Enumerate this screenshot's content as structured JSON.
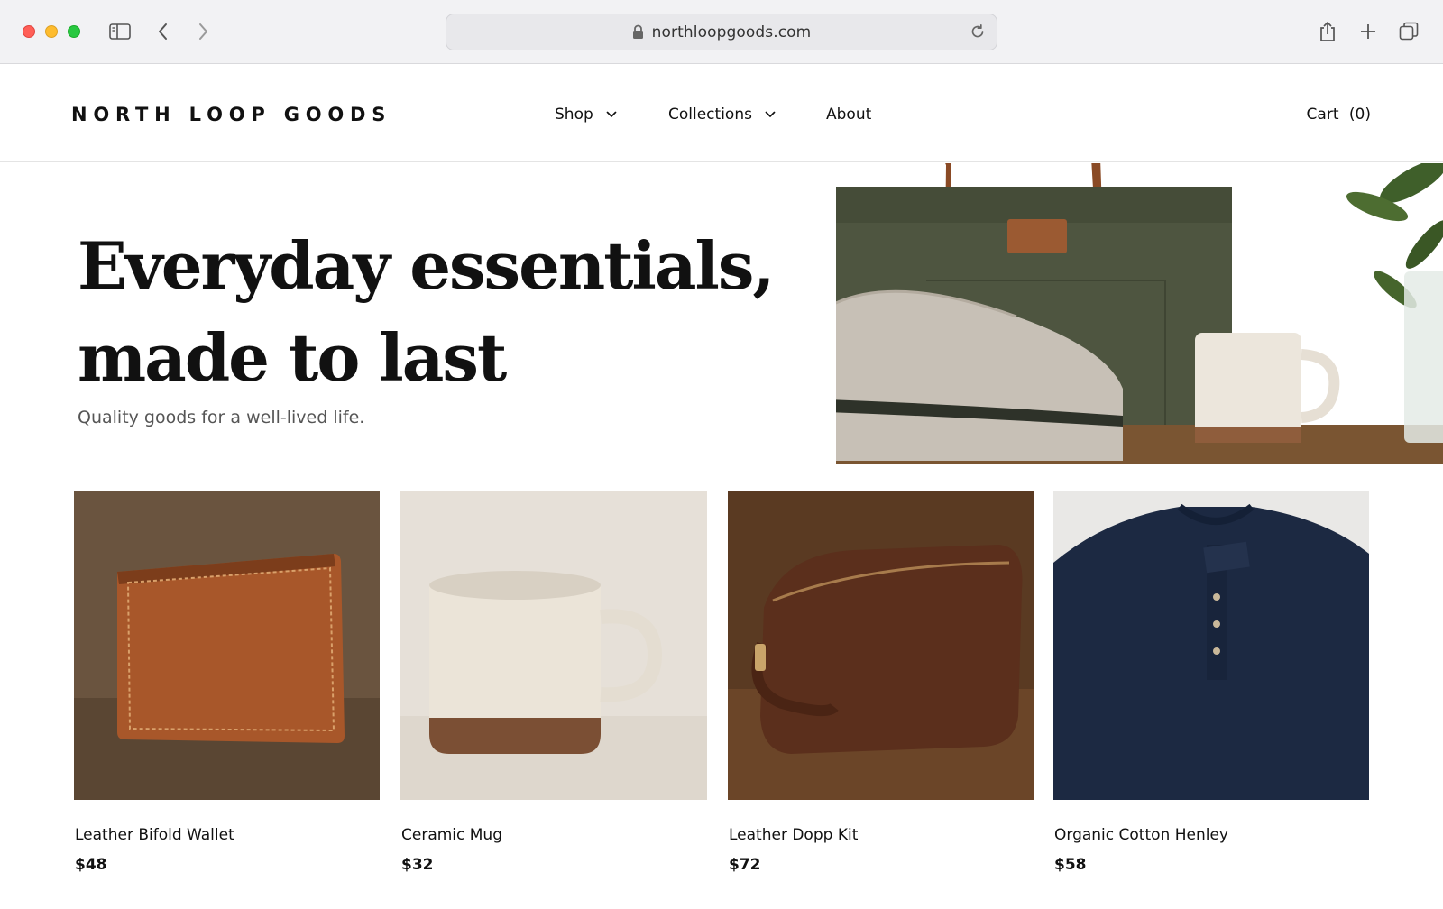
{
  "browser": {
    "url": "northloopgoods.com",
    "icons": [
      "sidebar-icon",
      "back-icon",
      "forward-icon",
      "lock-icon",
      "reload-icon",
      "share-icon",
      "new-tab-icon",
      "tabs-overview-icon"
    ]
  },
  "site": {
    "logo": "NORTH LOOP GOODS",
    "nav": [
      {
        "label": "Shop",
        "has_dropdown": true
      },
      {
        "label": "Collections",
        "has_dropdown": true
      },
      {
        "label": "About",
        "has_dropdown": false
      }
    ],
    "cart_label": "Cart",
    "cart_count": "(0)"
  },
  "hero": {
    "title_line1": "Everyday essentials,",
    "title_line2": "made to last",
    "subtitle": "Quality goods for a well-lived life."
  },
  "products": [
    {
      "name": "Leather Bifold Wallet",
      "price": "$48"
    },
    {
      "name": "Ceramic Mug",
      "price": "$32"
    },
    {
      "name": "Leather Dopp Kit",
      "price": "$72"
    },
    {
      "name": "Organic Cotton Henley",
      "price": "$58"
    }
  ],
  "colors": {
    "accent_text": "#111111",
    "muted_text": "#555555",
    "traffic_red": "#ff5f57",
    "traffic_yellow": "#febc2e",
    "traffic_green": "#28c840"
  }
}
